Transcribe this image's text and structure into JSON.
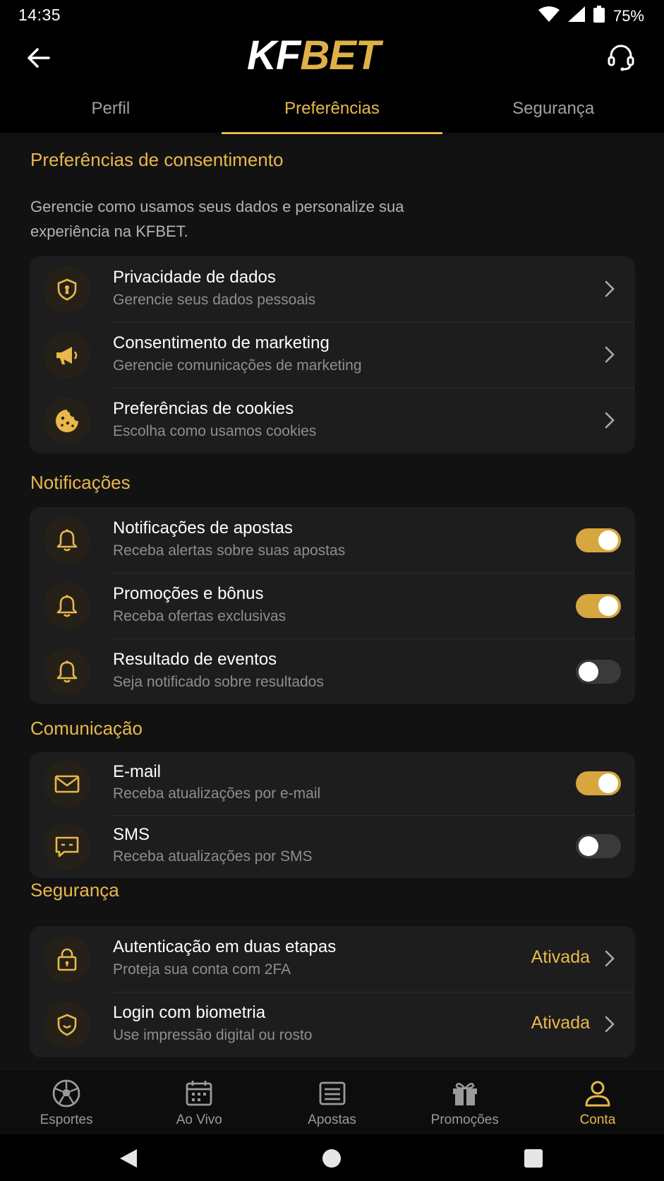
{
  "status": {
    "time": "14:35",
    "battery": "75%"
  },
  "header": {
    "logo_kf": "KF",
    "logo_bet": "BET"
  },
  "tabs": [
    {
      "label": "Perfil"
    },
    {
      "label": "Preferências"
    },
    {
      "label": "Segurança"
    }
  ],
  "consent": {
    "title": "Preferências de consentimento",
    "description": "Gerencie como usamos seus dados e personalize sua experiência na KFBET.",
    "items": [
      {
        "title": "Privacidade de dados",
        "subtitle": "Gerencie seus dados pessoais",
        "icon": "shield-icon"
      },
      {
        "title": "Consentimento de marketing",
        "subtitle": "Gerencie comunicações de marketing",
        "icon": "megaphone-icon"
      },
      {
        "title": "Preferências de cookies",
        "subtitle": "Escolha como usamos cookies",
        "icon": "cookie-icon"
      }
    ]
  },
  "notifications": {
    "title": "Notificações",
    "items": [
      {
        "title": "Notificações de apostas",
        "subtitle": "Receba alertas sobre suas apostas",
        "enabled": true,
        "icon": "bell-icon"
      },
      {
        "title": "Promoções e bônus",
        "subtitle": "Receba ofertas exclusivas",
        "enabled": true,
        "icon": "bell-icon"
      },
      {
        "title": "Resultado de eventos",
        "subtitle": "Seja notificado sobre resultados",
        "enabled": false,
        "icon": "bell-icon"
      }
    ]
  },
  "communication": {
    "title": "Comunicação",
    "items": [
      {
        "title": "E-mail",
        "subtitle": "Receba atualizações por e-mail",
        "enabled": true,
        "icon": "mail-icon"
      },
      {
        "title": "SMS",
        "subtitle": "Receba atualizações por SMS",
        "enabled": false,
        "icon": "message-icon"
      }
    ]
  },
  "security": {
    "title": "Segurança",
    "items": [
      {
        "title": "Autenticação em duas etapas",
        "subtitle": "Proteja sua conta com 2FA",
        "status": "Ativada",
        "icon": "lock-icon"
      },
      {
        "title": "Login com biometria",
        "subtitle": "Use impressão digital ou rosto",
        "status": "Ativada",
        "icon": "shield-face-icon"
      }
    ]
  },
  "bottom_nav": [
    {
      "label": "Esportes",
      "icon": "soccer-ball-icon"
    },
    {
      "label": "Ao Vivo",
      "icon": "calendar-icon"
    },
    {
      "label": "Apostas",
      "icon": "ticket-icon"
    },
    {
      "label": "Promoções",
      "icon": "gift-icon"
    },
    {
      "label": "Conta",
      "icon": "user-icon"
    }
  ],
  "colors": {
    "accent": "#e9b84a",
    "background": "#121212",
    "card": "#1d1d1d"
  }
}
